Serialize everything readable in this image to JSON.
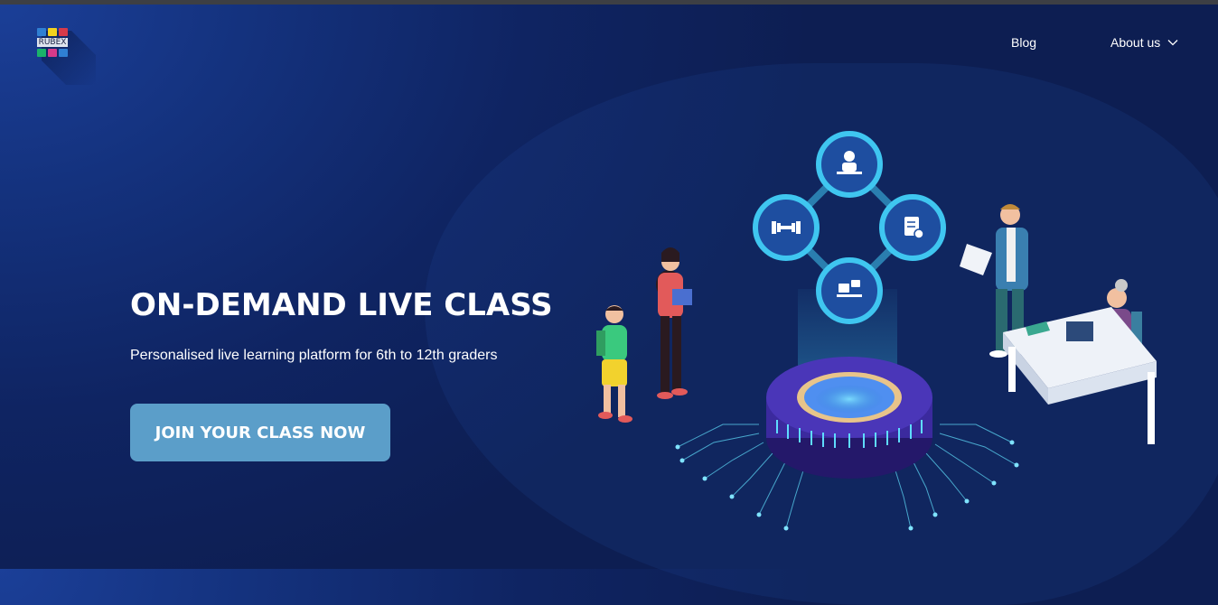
{
  "logo": {
    "text": "RUBEX",
    "cells": [
      "#2f7fd3",
      "#f2d21d",
      "#d63a4a",
      "#1bb36a",
      "#d63a8a",
      "#2f7fd3"
    ]
  },
  "nav": {
    "items": [
      {
        "label": "Blog"
      },
      {
        "label": "About us",
        "icon": "chevron-down-icon"
      }
    ]
  },
  "hero": {
    "title": "ON-DEMAND LIVE CLASS",
    "subtitle": "Personalised live learning platform for 6th to 12th graders",
    "cta_label": "JOIN YOUR CLASS NOW"
  },
  "colors": {
    "background": "#0f2462",
    "cta": "#5b9ec9",
    "glow": "#3fc6f0",
    "platform": "#3b2a9e"
  },
  "illustration": {
    "icons": [
      "teacher-icon",
      "dumbbell-icon",
      "document-check-icon",
      "classroom-icon"
    ]
  }
}
